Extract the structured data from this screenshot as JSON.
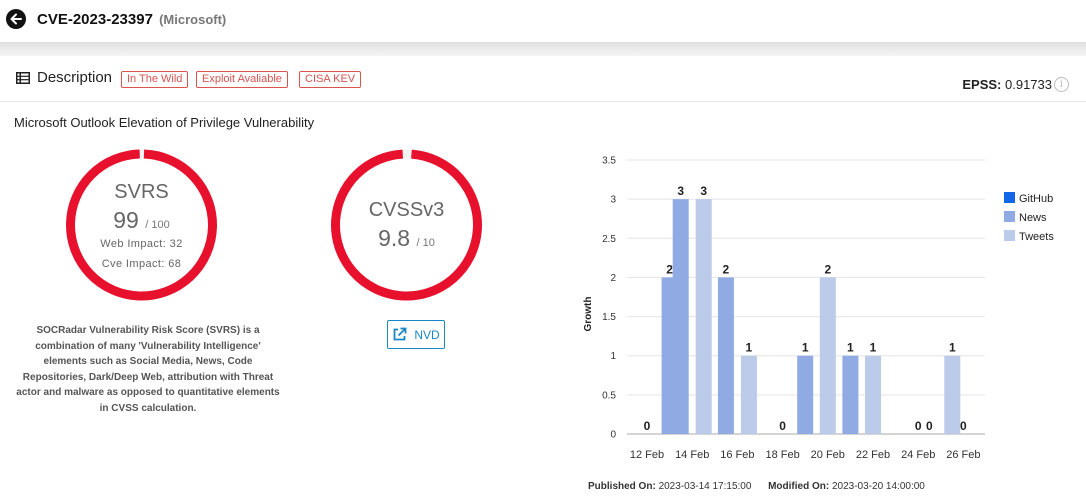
{
  "header": {
    "cve_id": "CVE-2023-23397",
    "vendor": "(Microsoft)"
  },
  "description": {
    "title": "Description",
    "tags": [
      "In The Wild",
      "Exploit Avaliable",
      "CISA KEV"
    ],
    "epss_label": "EPSS:",
    "epss_value": "0.91733",
    "info_icon": "i",
    "text": "Microsoft Outlook Elevation of Privilege Vulnerability"
  },
  "svrs": {
    "label": "SVRS",
    "score": "99",
    "max": "/ 100",
    "web_impact": "Web Impact: 32",
    "cve_impact": "Cve Impact: 68",
    "fill_fraction": 0.99,
    "explanation": "SOCRadar Vulnerability Risk Score (SVRS) is a combination of many 'Vulnerability Intelligence' elements such as Social Media, News, Code Repositories, Dark/Deep Web, attribution with Threat actor and malware as opposed to quantitative elements in CVSS calculation."
  },
  "cvss": {
    "label": "CVSSv3",
    "score": "9.8",
    "max": "/ 10",
    "fill_fraction": 0.98,
    "button_label": "NVD",
    "button_icon": "external-link-icon"
  },
  "colors": {
    "gauge": "#e8112d",
    "accent": "#1a87c5",
    "tag": "#d9534f",
    "github": "#1166e8",
    "news": "#90abe3",
    "tweets": "#bccbea"
  },
  "chart_data": {
    "type": "bar",
    "ylabel": "Growth",
    "xlabel": "",
    "ylim": [
      0,
      3.5
    ],
    "yticks": [
      "0",
      "0.5",
      "1",
      "1.5",
      "2",
      "2.5",
      "3",
      "3.5"
    ],
    "xticks": [
      "12 Feb",
      "14 Feb",
      "16 Feb",
      "18 Feb",
      "20 Feb",
      "22 Feb",
      "24 Feb",
      "26 Feb"
    ],
    "legend_position": "right",
    "legend": [
      "GitHub",
      "News",
      "Tweets"
    ],
    "points": [
      {
        "x": "2023-02-12",
        "series": "Tweets",
        "value": 0
      },
      {
        "x": "2023-02-13",
        "series": "News",
        "value": 2
      },
      {
        "x": "2023-02-14",
        "series": "News",
        "value": 3
      },
      {
        "x": "2023-02-14",
        "series": "Tweets",
        "value": 3
      },
      {
        "x": "2023-02-16",
        "series": "News",
        "value": 2
      },
      {
        "x": "2023-02-16",
        "series": "Tweets",
        "value": 1
      },
      {
        "x": "2023-02-18",
        "series": "Tweets",
        "value": 0
      },
      {
        "x": "2023-02-19",
        "series": "News",
        "value": 1
      },
      {
        "x": "2023-02-20",
        "series": "Tweets",
        "value": 2
      },
      {
        "x": "2023-02-21",
        "series": "News",
        "value": 1
      },
      {
        "x": "2023-02-22",
        "series": "Tweets",
        "value": 1
      },
      {
        "x": "2023-02-24",
        "series": "Tweets",
        "value": 0
      },
      {
        "x": "2023-02-25",
        "series": "Tweets",
        "value": 0
      },
      {
        "x": "2023-02-25",
        "series": "Tweets",
        "value": 1
      },
      {
        "x": "2023-02-26",
        "series": "Tweets",
        "value": 0
      }
    ]
  },
  "footer": {
    "published_label": "Published On:",
    "published_value": "2023-03-14 17:15:00",
    "modified_label": "Modified On:",
    "modified_value": "2023-03-20 14:00:00"
  }
}
